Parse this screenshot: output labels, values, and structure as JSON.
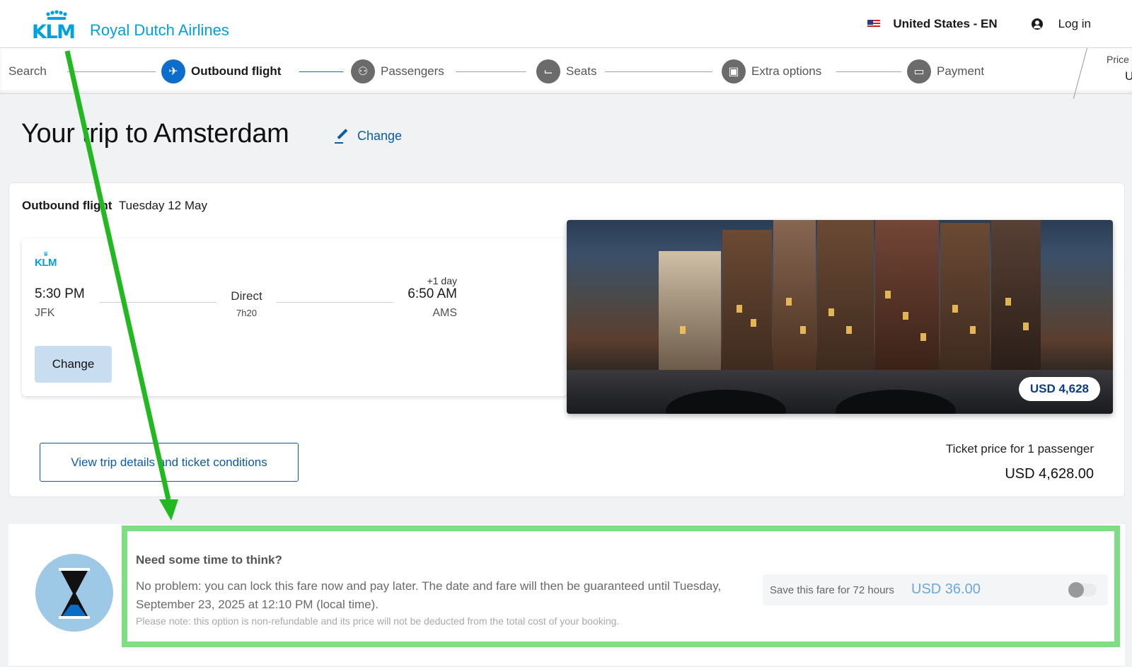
{
  "header": {
    "brand": "KLM",
    "brand_name": "Royal Dutch Airlines",
    "locale": "United States - EN",
    "login_label": "Log in",
    "flag_icon": "us-flag-icon",
    "user_icon": "user-icon"
  },
  "steps": [
    {
      "label": "Search",
      "icon": "search-step",
      "state": "done"
    },
    {
      "label": "Outbound flight",
      "icon": "plane-icon",
      "state": "active"
    },
    {
      "label": "Passengers",
      "icon": "passengers-icon",
      "state": "todo"
    },
    {
      "label": "Seats",
      "icon": "seat-icon",
      "state": "todo"
    },
    {
      "label": "Extra options",
      "icon": "luggage-icon",
      "state": "todo"
    },
    {
      "label": "Payment",
      "icon": "card-icon",
      "state": "todo"
    }
  ],
  "price_tab": {
    "label": "Price",
    "value": "U"
  },
  "page": {
    "title": "Your trip to Amsterdam",
    "change_label": "Change"
  },
  "flight": {
    "section_label": "Outbound flight",
    "date": "Tuesday 12 May",
    "airline": "KLM",
    "departure_time": "5:30 PM",
    "departure_code": "JFK",
    "stops": "Direct",
    "duration": "7h20",
    "day_offset": "+1 day",
    "arrival_time": "6:50 AM",
    "arrival_code": "AMS",
    "change_button": "Change",
    "photo_price": "USD 4,628",
    "details_button": "View trip details and ticket conditions",
    "ticket_label": "Ticket price for 1 passenger",
    "ticket_price": "USD 4,628.00"
  },
  "hold": {
    "title": "Need some time to think?",
    "body": "No problem: you can lock this fare now and pay later. The date and fare will then be guaranteed until Tuesday, September 23, 2025 at 12:10 PM (local time).",
    "note": "Please note: this option is non-refundable and its price will not be deducted from the total cost of your booking.",
    "save_label": "Save this fare for 72 hours",
    "save_price": "USD 36.00",
    "toggle_on": false
  },
  "colors": {
    "brand_blue": "#00a1de",
    "link_blue": "#0b5ba8",
    "active_step": "#0d6dcc",
    "highlight_green": "#7fdd83",
    "arrow_green": "#22b822"
  }
}
